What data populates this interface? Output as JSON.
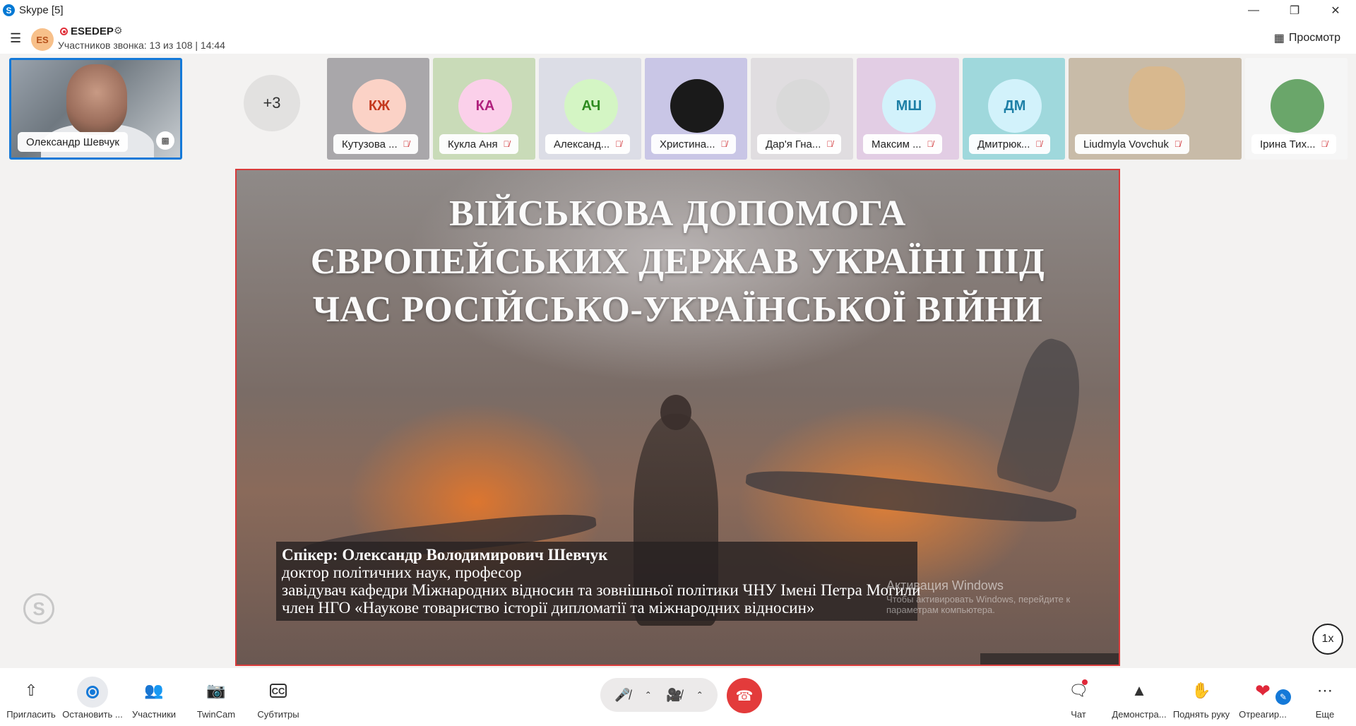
{
  "window": {
    "app_title": "Skype [5]",
    "app_icon_letter": "S"
  },
  "call": {
    "avatar_initials": "ES",
    "name": "ESEDEP",
    "subtitle": "Участников звонка: 13 из 108 | 14:44",
    "view_label": "Просмотр"
  },
  "self_tile": {
    "name": "Олександр Шевчук"
  },
  "overflow": {
    "label": "+3"
  },
  "participants": [
    {
      "label": "Кутузова ...",
      "initials": "КЖ",
      "avatar_bg": "#fbd2c6",
      "avatar_fg": "#c4391e",
      "tile_bg": "#a9a7aa"
    },
    {
      "label": "Кукла Аня",
      "initials": "КА",
      "avatar_bg": "#fbd0ea",
      "avatar_fg": "#b0217d",
      "tile_bg": "#c9dbb8"
    },
    {
      "label": "Александ...",
      "initials": "АЧ",
      "avatar_bg": "#d4f5c4",
      "avatar_fg": "#2d8b1f",
      "tile_bg": "#dcdde6"
    },
    {
      "label": "Христина...",
      "initials": "",
      "avatar_bg": "#1a1a1a",
      "avatar_fg": "#ffffff",
      "tile_bg": "#c9c6e6"
    },
    {
      "label": "Дар'я Гна...",
      "initials": "",
      "avatar_bg": "#d9d9d9",
      "avatar_fg": "#333333",
      "tile_bg": "#e0dde0"
    },
    {
      "label": "Максим ...",
      "initials": "МШ",
      "avatar_bg": "#d2f2fb",
      "avatar_fg": "#1d7fa6",
      "tile_bg": "#e2cde4"
    },
    {
      "label": "Дмитрюк...",
      "initials": "ДМ",
      "avatar_bg": "#d2f2fb",
      "avatar_fg": "#1d7fa6",
      "tile_bg": "#9fd8dc"
    },
    {
      "label": "Liudmyla Vovchuk",
      "initials": "",
      "avatar_bg": "#d8b88e",
      "avatar_fg": "#333333",
      "tile_bg": "#c8bba8"
    },
    {
      "label": "Ірина Тих...",
      "initials": "",
      "avatar_bg": "#6aa66a",
      "avatar_fg": "#ffffff",
      "tile_bg": "#f6f6f6"
    }
  ],
  "slide": {
    "title_lines": [
      "ВІЙСЬКОВА ДОПОМОГА",
      "ЄВРОПЕЙСЬКИХ ДЕРЖАВ УКРАЇНІ ПІД",
      "ЧАС РОСІЙСЬКО-УКРАЇНСЬКОЇ ВІЙНИ"
    ],
    "speaker_name": "Спікер: Олександр Володимирович Шевчук",
    "speaker_lines": [
      "доктор політичних наук, професор",
      "завідувач кафедри Міжнародних відносин та зовнішньої політики ЧНУ Імені Петра Могили",
      "член НГО «Наукове товариство історії дипломатії та міжнародних відносин»"
    ],
    "activation_title": "Активация Windows",
    "activation_sub": "Чтобы активировать Windows, перейдите к параметрам компьютера."
  },
  "speed": "1x",
  "bottom_left": [
    {
      "label": "Пригласить",
      "icon": "share-icon"
    },
    {
      "label": "Остановить ...",
      "icon": "record-stop-icon"
    },
    {
      "label": "Участники",
      "icon": "participants-icon"
    },
    {
      "label": "TwinCam",
      "icon": "twincam-icon"
    },
    {
      "label": "Субтитры",
      "icon": "captions-icon"
    }
  ],
  "bottom_right": [
    {
      "label": "Чат",
      "icon": "chat-icon"
    },
    {
      "label": "Демонстра...",
      "icon": "present-icon"
    },
    {
      "label": "Поднять руку",
      "icon": "raise-hand-icon"
    },
    {
      "label": "Отреагир...",
      "icon": "heart-icon"
    },
    {
      "label": "Еще",
      "icon": "more-icon"
    }
  ],
  "colors": {
    "accent": "#1479d8",
    "hangup": "#e33b3b",
    "share_border": "#d83b3b"
  }
}
